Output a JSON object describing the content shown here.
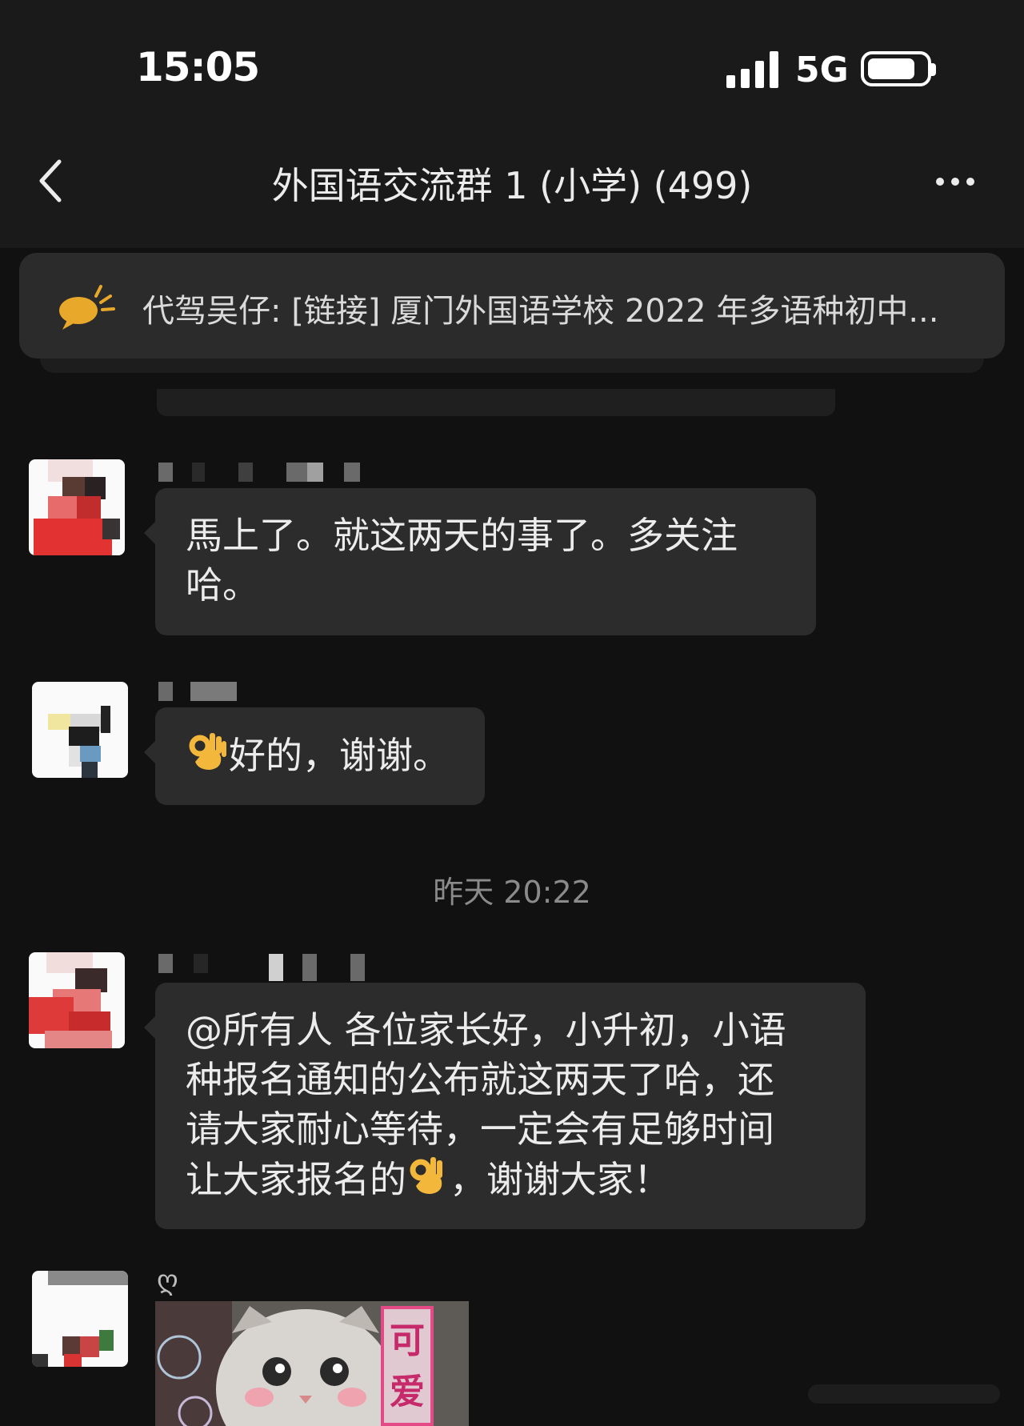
{
  "status_bar": {
    "time": "15:05",
    "network": "5G",
    "signal_bars": 4
  },
  "header": {
    "title": "外国语交流群 1 (小学) (499)"
  },
  "announcement": {
    "text": "代驾吴仔: [链接] 厦门外国语学校 2022 年多语种初中..."
  },
  "messages": [
    {
      "lines": [
        "馬上了。就这两天的事了。多关注",
        "哈。"
      ]
    },
    {
      "text": "好的，谢谢。",
      "emoji": "ok-hand"
    },
    {
      "lines": [
        "@所有人 各位家长好，小升初，小语",
        "种报名通知的公布就这两天了哈，还",
        "请大家耐心等待，一定会有足够时间"
      ],
      "last_line_before": "让大家报名的",
      "last_line_after": "，谢谢大家！",
      "emoji": "ok-hand"
    },
    {
      "sender": "ღ",
      "sticker_text": "可爱"
    }
  ],
  "timestamp": "昨天 20:22",
  "colors": {
    "background": "#111111",
    "bubble": "#2c2c2c",
    "text": "#ececec",
    "notice_icon": "#e8a82a"
  }
}
